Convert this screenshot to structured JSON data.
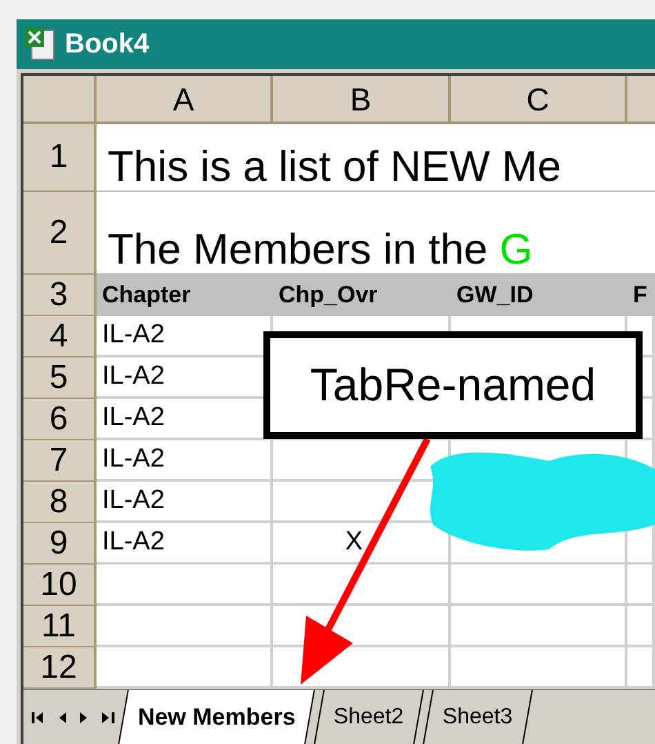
{
  "window": {
    "title": "Book4"
  },
  "columns": [
    "A",
    "B",
    "C"
  ],
  "rows": [
    {
      "number": "1",
      "kind": "title",
      "text": "This is a list of NEW Me"
    },
    {
      "number": "2",
      "kind": "title",
      "text": "The Members in the ",
      "highlight": "G"
    },
    {
      "number": "3",
      "kind": "header",
      "cells": [
        "Chapter",
        "Chp_Ovr",
        "GW_ID",
        "F"
      ]
    },
    {
      "number": "4",
      "kind": "data",
      "cells": [
        "IL-A2",
        "",
        "",
        ""
      ]
    },
    {
      "number": "5",
      "kind": "data",
      "cells": [
        "IL-A2",
        "",
        "",
        ""
      ]
    },
    {
      "number": "6",
      "kind": "data",
      "cells": [
        "IL-A2",
        "",
        "",
        ""
      ]
    },
    {
      "number": "7",
      "kind": "data",
      "cells": [
        "IL-A2",
        "",
        "",
        ""
      ]
    },
    {
      "number": "8",
      "kind": "data",
      "cells": [
        "IL-A2",
        "",
        "",
        ""
      ]
    },
    {
      "number": "9",
      "kind": "data",
      "cells": [
        "IL-A2",
        "X",
        "",
        ""
      ]
    },
    {
      "number": "10",
      "kind": "data",
      "cells": [
        "",
        "",
        "",
        ""
      ]
    },
    {
      "number": "11",
      "kind": "data",
      "cells": [
        "",
        "",
        "",
        ""
      ]
    },
    {
      "number": "12",
      "kind": "data",
      "cells": [
        "",
        "",
        "",
        ""
      ]
    }
  ],
  "callout": {
    "text": "TabRe-named"
  },
  "sheet_tabs": [
    {
      "label": "New Members",
      "selected": true
    },
    {
      "label": "Sheet2",
      "selected": false
    },
    {
      "label": "Sheet3",
      "selected": false
    }
  ]
}
